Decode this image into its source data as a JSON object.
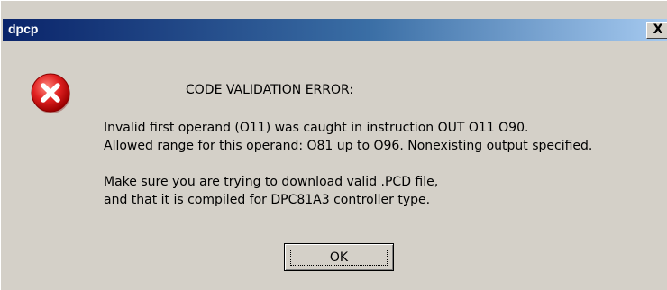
{
  "window": {
    "title": "dpcp",
    "close_glyph": "X"
  },
  "dialog": {
    "icon": "error-icon",
    "heading": "CODE VALIDATION ERROR:",
    "lines": [
      "Invalid first operand (O11) was caught in instruction OUT O11 O90.",
      "Allowed range for this operand: O81 up to O96. Nonexisting output specified.",
      "Make sure you are trying to download valid .PCD file,",
      "and that it is compiled for DPC81A3 controller type."
    ],
    "ok_label": "OK"
  },
  "colors": {
    "title_start": "#0a246a",
    "title_end": "#a6caf0",
    "face": "#d4d0c8",
    "error_red": "#e02020"
  }
}
